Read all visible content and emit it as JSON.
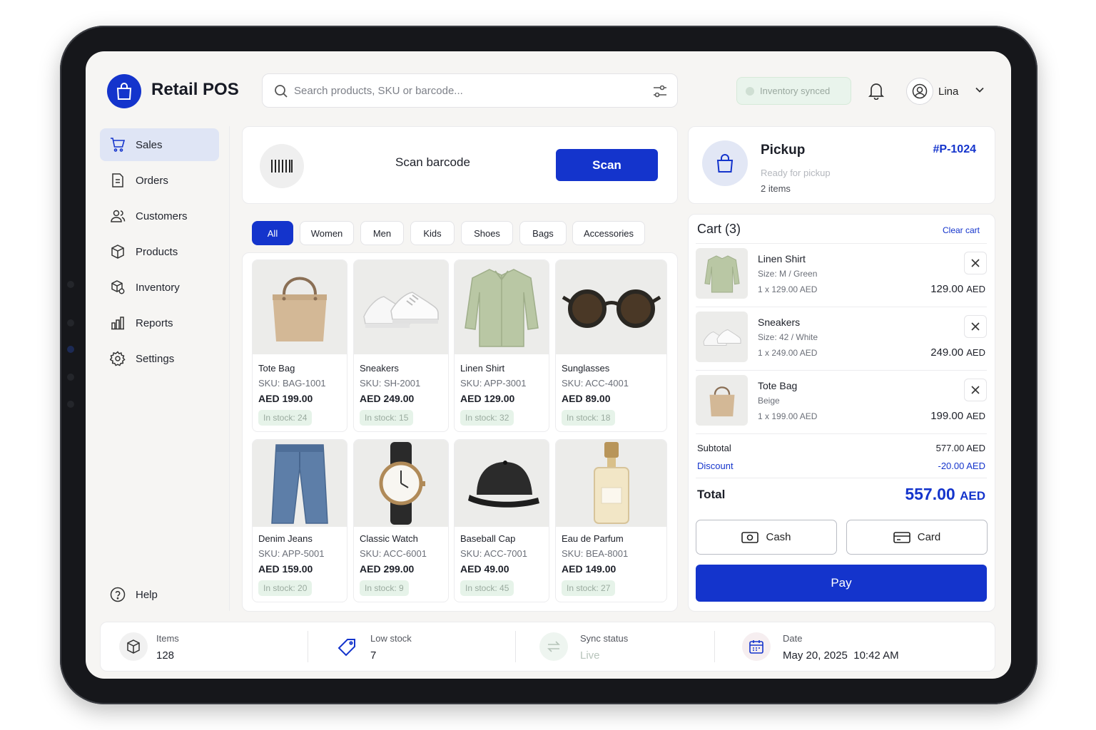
{
  "app": {
    "title": "Retail POS"
  },
  "search": {
    "placeholder": "Search products, SKU or barcode..."
  },
  "header": {
    "sync_status": "Inventory synced",
    "user_name": "Lina"
  },
  "sidebar": {
    "items": [
      {
        "label": "Sales",
        "icon": "cart-icon"
      },
      {
        "label": "Orders",
        "icon": "document-icon"
      },
      {
        "label": "Customers",
        "icon": "users-icon"
      },
      {
        "label": "Products",
        "icon": "box-icon"
      },
      {
        "label": "Inventory",
        "icon": "inventory-icon"
      },
      {
        "label": "Reports",
        "icon": "chart-icon"
      },
      {
        "label": "Settings",
        "icon": "gear-icon"
      }
    ],
    "help_label": "Help"
  },
  "scan": {
    "label": "Scan barcode",
    "button": "Scan"
  },
  "categories": [
    "All",
    "Women",
    "Men",
    "Kids",
    "Shoes",
    "Bags",
    "Accessories"
  ],
  "products": [
    {
      "name": "Tote Bag",
      "sku": "SKU: BAG-1001",
      "price": "AED 199.00",
      "stock": "In stock: 24",
      "icon": "tote-bag-image"
    },
    {
      "name": "Sneakers",
      "sku": "SKU: SH-2001",
      "price": "AED 249.00",
      "stock": "In stock: 15",
      "icon": "sneakers-image"
    },
    {
      "name": "Linen Shirt",
      "sku": "SKU: APP-3001",
      "price": "AED 129.00",
      "stock": "In stock: 32",
      "icon": "shirt-image"
    },
    {
      "name": "Sunglasses",
      "sku": "SKU: ACC-4001",
      "price": "AED 89.00",
      "stock": "In stock: 18",
      "icon": "sunglasses-image"
    },
    {
      "name": "Denim Jeans",
      "sku": "SKU: APP-5001",
      "price": "AED 159.00",
      "stock": "In stock: 20",
      "icon": "jeans-image"
    },
    {
      "name": "Classic Watch",
      "sku": "SKU: ACC-6001",
      "price": "AED 299.00",
      "stock": "In stock: 9",
      "icon": "watch-image"
    },
    {
      "name": "Baseball Cap",
      "sku": "SKU: ACC-7001",
      "price": "AED 49.00",
      "stock": "In stock: 45",
      "icon": "cap-image"
    },
    {
      "name": "Eau de Parfum",
      "sku": "SKU: BEA-8001",
      "price": "AED 149.00",
      "stock": "In stock: 27",
      "icon": "perfume-image"
    }
  ],
  "order": {
    "type": "Pickup",
    "id": "#P-1024",
    "status": "Ready for pickup",
    "count": "2 items"
  },
  "cart": {
    "title": "Cart (3)",
    "clear": "Clear cart",
    "items": [
      {
        "name": "Linen Shirt",
        "variant": "Size: M / Green",
        "qty": "1 x 129.00 AED",
        "amount": "129.00",
        "currency": "AED"
      },
      {
        "name": "Sneakers",
        "variant": "Size: 42 / White",
        "qty": "1 x 249.00 AED",
        "amount": "249.00",
        "currency": "AED"
      },
      {
        "name": "Tote Bag",
        "variant": "Beige",
        "qty": "1 x 199.00 AED",
        "amount": "199.00",
        "currency": "AED"
      }
    ],
    "subtotal_label": "Subtotal",
    "subtotal": "577.00 AED",
    "discount_label": "Discount",
    "discount": "-20.00 AED",
    "total_label": "Total",
    "total": "557.00",
    "total_currency": "AED",
    "cash": "Cash",
    "card": "Card",
    "pay": "Pay"
  },
  "stats": [
    {
      "label": "Items",
      "value": "128"
    },
    {
      "label": "Low stock",
      "value": "7"
    },
    {
      "label": "Sync status",
      "value": "Live"
    },
    {
      "label": "Date",
      "value": "May 20, 2025  10:42 AM"
    }
  ],
  "colors": {
    "accent": "#1434cc",
    "stock_bg": "#e6f3e9",
    "sync_bg": "#e9f4ec"
  }
}
